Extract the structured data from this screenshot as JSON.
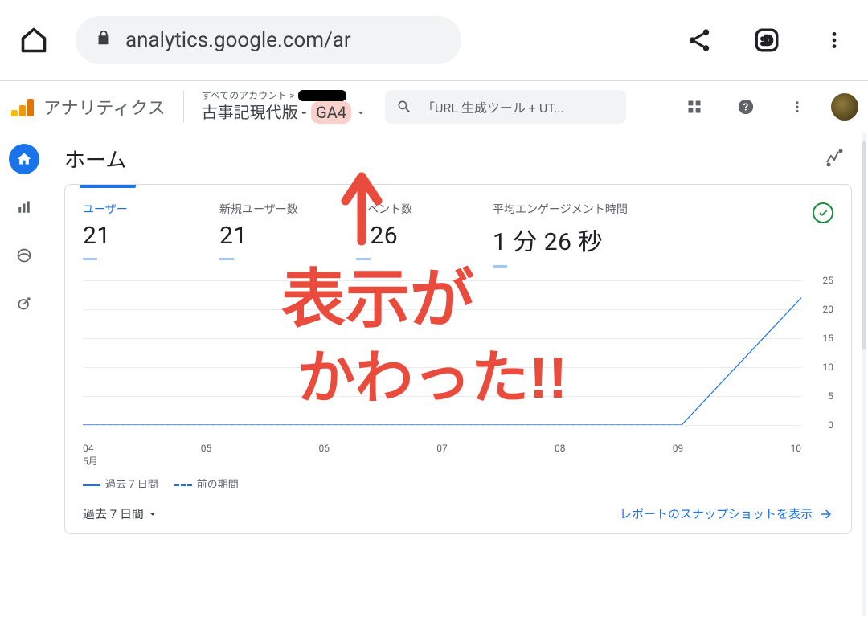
{
  "browser": {
    "url_display": "analytics.google.com/ar"
  },
  "header": {
    "app_name": "アナリティクス",
    "accounts_prefix": "すべてのアカウント >",
    "property_name_part1": "古事記現代版 -",
    "property_name_part2": "GA4",
    "search_placeholder": "「URL 生成ツール + UT..."
  },
  "page": {
    "title": "ホーム"
  },
  "card": {
    "metrics": [
      {
        "label": "ユーザー",
        "value": "21"
      },
      {
        "label": "新規ユーザー数",
        "value": "21"
      },
      {
        "label": "イベント数",
        "value": "126"
      },
      {
        "label": "平均エンゲージメント時間",
        "value": "1 分 26 秒"
      }
    ],
    "legend_current": "過去 7 日間",
    "legend_previous": "前の期間",
    "date_range_label": "過去 7 日間",
    "snapshot_link": "レポートのスナップショットを表示"
  },
  "chart_data": {
    "type": "line",
    "title": "",
    "xlabel": "5月",
    "ylabel": "",
    "ylim": [
      0,
      25
    ],
    "y_ticks": [
      0,
      5,
      10,
      15,
      20,
      25
    ],
    "categories": [
      "04",
      "05",
      "06",
      "07",
      "08",
      "09",
      "10"
    ],
    "series": [
      {
        "name": "過去 7 日間",
        "style": "solid",
        "values": [
          0,
          0,
          0,
          0,
          0,
          0,
          22
        ]
      },
      {
        "name": "前の期間",
        "style": "dashed",
        "values": [
          0,
          0,
          0,
          0,
          0,
          0,
          null
        ]
      }
    ]
  },
  "annotation": {
    "text_line1": "表示が",
    "text_line2": "かわった!!",
    "color": "#e94b3c"
  }
}
